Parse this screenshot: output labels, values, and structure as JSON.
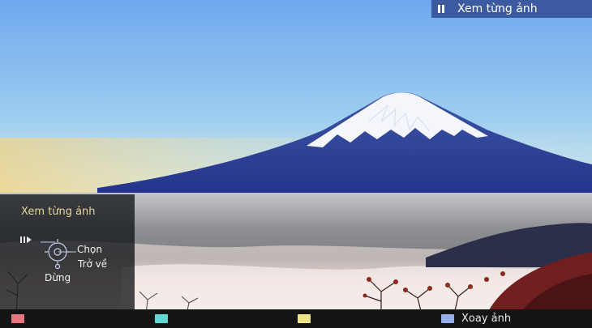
{
  "top_indicator": {
    "label": "Xem từng ảnh",
    "icon": "pause-icon"
  },
  "panel": {
    "title": "Xem từng ảnh",
    "play_pause_icon": "play-pause-icon",
    "dpad_icon": "dpad-icon",
    "select_label": "Chọn",
    "back_label": "Trở về",
    "stop_label": "Dừng"
  },
  "color_keys": [
    {
      "name": "red",
      "color": "#e8767e",
      "label": ""
    },
    {
      "name": "green",
      "color": "#5fd7d4",
      "label": ""
    },
    {
      "name": "yellow",
      "color": "#eee487",
      "label": ""
    },
    {
      "name": "blue",
      "color": "#93b0e8",
      "label": "Xoay ảnh"
    }
  ]
}
